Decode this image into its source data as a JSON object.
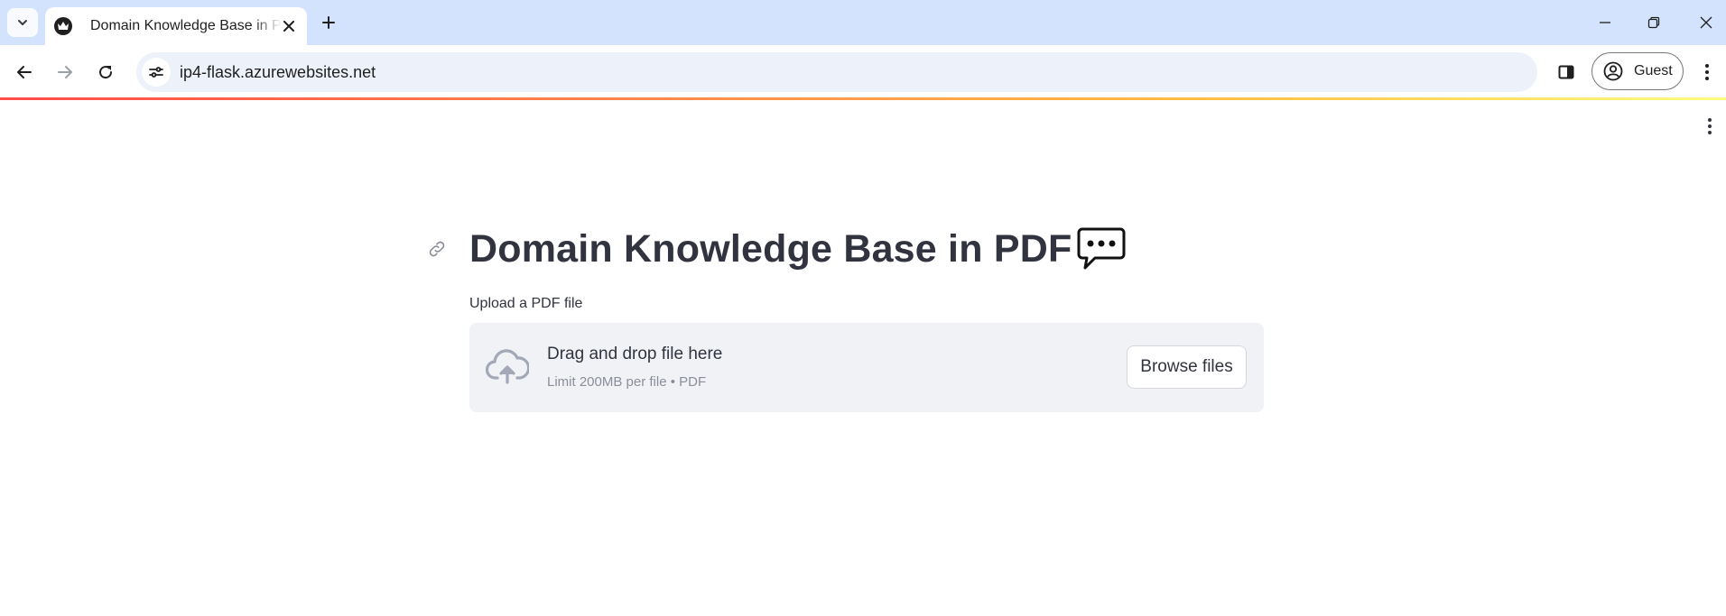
{
  "browser": {
    "tab": {
      "title": "Domain Knowledge Base in PDF",
      "favicon": "streamlit-crown-icon"
    },
    "url": "ip4-flask.azurewebsites.net",
    "profile_label": "Guest",
    "colors": {
      "tabstrip": "#d3e3fd",
      "omnibox": "#edf1f9"
    }
  },
  "app": {
    "title": "Domain Knowledge Base in PDF",
    "title_icon": "speech-balloon-icon",
    "uploader": {
      "label": "Upload a PDF file",
      "instructions": "Drag and drop file here",
      "limit": "Limit 200MB per file • PDF",
      "button": "Browse files",
      "icon": "cloud-upload-icon"
    },
    "colors": {
      "text": "#31333f",
      "dropzone_bg": "#f0f2f6",
      "header_gradient": [
        "#ff4b4b",
        "#ffbd45",
        "#fffd80"
      ]
    }
  }
}
